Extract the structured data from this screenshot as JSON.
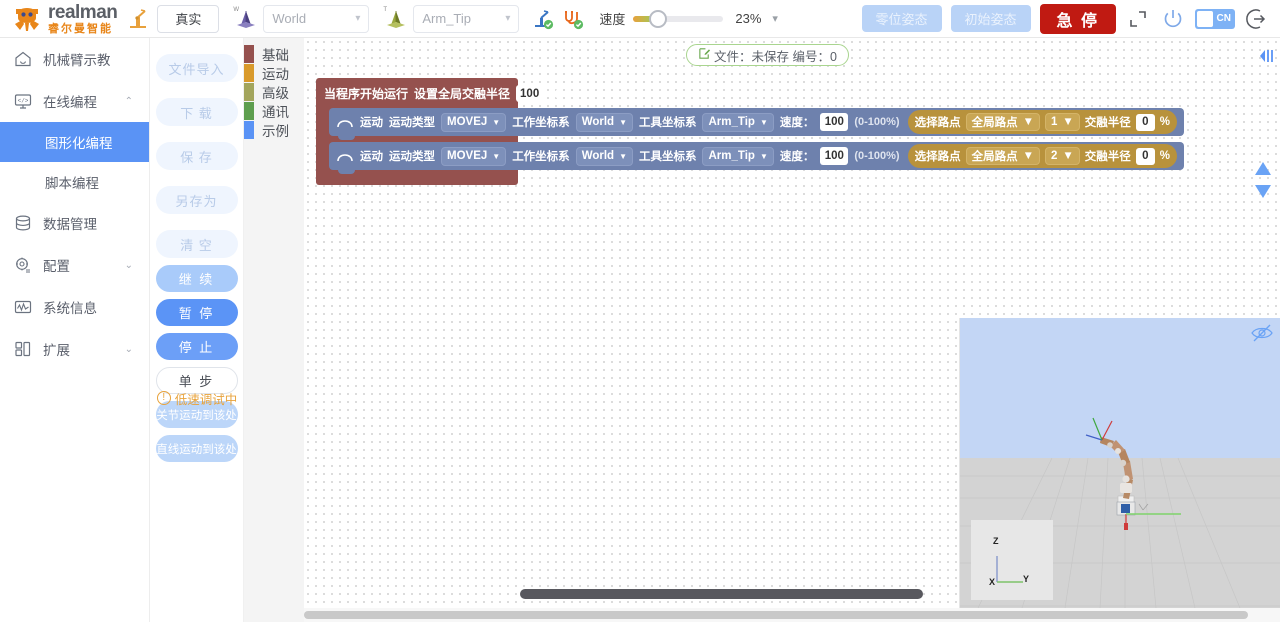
{
  "header": {
    "brand_top": "realman",
    "brand_bottom": "睿尔曼智能",
    "robot_icon": "robot-arm-icon",
    "mode_button": "真实",
    "work_frame": {
      "icon": "world-axes-icon",
      "axis_label": "W",
      "value": "World"
    },
    "tool_frame": {
      "icon": "tool-axes-icon",
      "axis_label": "T",
      "value": "Arm_Tip"
    },
    "connect_icon": "robot-connected-icon",
    "cable_icon": "cable-connected-icon",
    "speed_label": "速度",
    "speed_value": "23%",
    "speed_percent": 23,
    "zero_pose_button": "零位姿态",
    "init_pose_button": "初始姿态",
    "estop_button": "急 停",
    "fullscreen_icon": "fullscreen-icon",
    "power_icon": "power-icon",
    "language_toggle": "CN",
    "logout_icon": "logout-icon"
  },
  "sidebar": {
    "items": [
      {
        "label": "机械臂示教",
        "icon": "home-icon",
        "expandable": false
      },
      {
        "label": "在线编程",
        "icon": "code-monitor-icon",
        "expandable": true,
        "arrow": "⌃"
      },
      {
        "label": "数据管理",
        "icon": "database-icon",
        "expandable": false
      },
      {
        "label": "配置",
        "icon": "gear-icon",
        "expandable": true,
        "arrow": "⌄"
      },
      {
        "label": "系统信息",
        "icon": "chart-pulse-icon",
        "expandable": false
      },
      {
        "label": "扩展",
        "icon": "grid-blocks-icon",
        "expandable": true,
        "arrow": "⌄"
      }
    ],
    "subitems": [
      {
        "label": "图形化编程",
        "active": true
      },
      {
        "label": "脚本编程",
        "active": false
      }
    ]
  },
  "toolcol": {
    "file_buttons": [
      "文件导入",
      "下 载",
      "保 存",
      "另存为",
      "清 空"
    ],
    "warning": {
      "icon": "warning-circle-icon",
      "text": "低速调试中"
    },
    "run_buttons": [
      {
        "label": "继 续",
        "style": "continue"
      },
      {
        "label": "暂 停",
        "style": "pause"
      },
      {
        "label": "停 止",
        "style": "stop"
      },
      {
        "label": "单 步",
        "style": "step"
      },
      {
        "label": "关节运动到该处",
        "style": "move"
      },
      {
        "label": "直线运动到该处",
        "style": "move"
      }
    ]
  },
  "categories": [
    {
      "label": "基础",
      "color": "#95514e"
    },
    {
      "label": "运动",
      "color": "#d99a2b"
    },
    {
      "label": "高级",
      "color": "#a3a55c"
    },
    {
      "label": "通讯",
      "color": "#5e9e4e"
    },
    {
      "label": "示例",
      "color": "#5a93f5"
    }
  ],
  "canvas": {
    "file_badge": {
      "icon": "edit-file-icon",
      "text": "文件：未保存 编号：0"
    },
    "collapse_icon": "collapse-panel-icon",
    "scroll_up_icon": "scroll-up-icon",
    "scroll_down_icon": "scroll-down-icon"
  },
  "program": {
    "hat_block": {
      "label_start": "当程序开始运行",
      "label_radius": "设置全局交融半径",
      "radius_value": "100",
      "unit": "%"
    },
    "motion_blocks": [
      {
        "icon": "motion-arc-icon",
        "name": "运动",
        "type_label": "运动类型",
        "type_value": "MOVEJ",
        "work_frame_label": "工作坐标系",
        "work_frame_value": "World",
        "tool_frame_label": "工具坐标系",
        "tool_frame_value": "Arm_Tip",
        "speed_label": "速度：",
        "speed_value": "100",
        "speed_hint": "(0-100%)",
        "waypoint_label": "选择路点",
        "waypoint_scope": "全局路点",
        "waypoint_index": "1",
        "blend_label": "交融半径",
        "blend_value": "0",
        "blend_unit": "%"
      },
      {
        "icon": "motion-arc-icon",
        "name": "运动",
        "type_label": "运动类型",
        "type_value": "MOVEJ",
        "work_frame_label": "工作坐标系",
        "work_frame_value": "World",
        "tool_frame_label": "工具坐标系",
        "tool_frame_value": "Arm_Tip",
        "speed_label": "速度：",
        "speed_value": "100",
        "speed_hint": "(0-100%)",
        "waypoint_label": "选择路点",
        "waypoint_scope": "全局路点",
        "waypoint_index": "2",
        "blend_label": "交融半径",
        "blend_value": "0",
        "blend_unit": "%"
      }
    ]
  },
  "viewport": {
    "hide_icon": "eye-hidden-icon",
    "axes": {
      "z": "Z",
      "y": "Y",
      "x": "X"
    }
  },
  "colors": {
    "accent": "#5a93f5",
    "estop": "#c01a12",
    "basic_block": "#95514e",
    "motion_block": "#6e81ad",
    "gold_block": "#b8923c",
    "brand_orange": "#e8861a",
    "warning": "#e8a33c"
  }
}
